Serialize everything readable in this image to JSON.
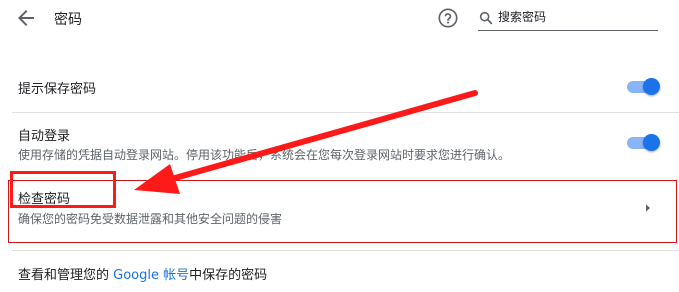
{
  "header": {
    "back_icon": "arrow-back-icon",
    "title": "密码",
    "help_icon": "help-circle-icon",
    "search_icon": "search-icon",
    "search_placeholder": "搜索密码"
  },
  "offer_to_save": {
    "label": "提示保存密码",
    "enabled": true
  },
  "auto_signin": {
    "label": "自动登录",
    "description": "使用存储的凭据自动登录网站。停用该功能后，系统会在您每次登录网站时要求您进行确认。",
    "enabled": true
  },
  "check_passwords": {
    "label": "检查密码",
    "description": "确保您的密码免受数据泄露和其他安全问题的侵害",
    "chevron_icon": "chevron-right-icon"
  },
  "manage": {
    "prefix": "查看和管理您的 ",
    "link": "Google 帐号",
    "suffix": "中保存的密码"
  },
  "colors": {
    "accent": "#1a73e8",
    "toggle_track": "#8ab4f8",
    "annotation_red": "#ff1a1a"
  }
}
